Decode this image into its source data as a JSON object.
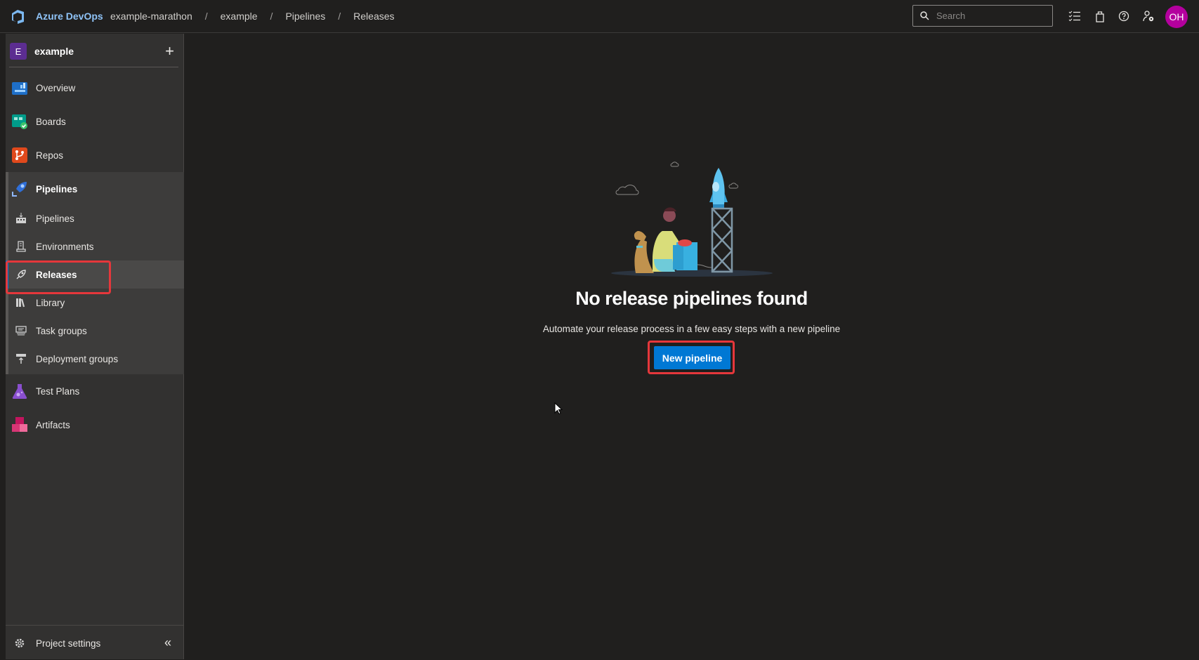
{
  "header": {
    "brand": "Azure DevOps",
    "breadcrumbs": [
      "example-marathon",
      "example",
      "Pipelines",
      "Releases"
    ],
    "breadcrumb_separator": "/",
    "search_placeholder": "Search",
    "avatar_initials": "OH",
    "avatar_color": "#b4009e"
  },
  "sidebar": {
    "project_initial": "E",
    "project_name": "example",
    "items": [
      {
        "label": "Overview",
        "icon": "overview-icon"
      },
      {
        "label": "Boards",
        "icon": "boards-icon"
      },
      {
        "label": "Repos",
        "icon": "repos-icon"
      },
      {
        "label": "Pipelines",
        "icon": "pipelines-icon"
      },
      {
        "label": "Test Plans",
        "icon": "test-plans-icon"
      },
      {
        "label": "Artifacts",
        "icon": "artifacts-icon"
      }
    ],
    "pipelines_sub": [
      {
        "label": "Pipelines",
        "icon": "pipelines-sub-icon"
      },
      {
        "label": "Environments",
        "icon": "environments-icon"
      },
      {
        "label": "Releases",
        "icon": "releases-icon",
        "selected": true
      },
      {
        "label": "Library",
        "icon": "library-icon"
      },
      {
        "label": "Task groups",
        "icon": "task-groups-icon"
      },
      {
        "label": "Deployment groups",
        "icon": "deployment-groups-icon"
      }
    ],
    "settings_label": "Project settings"
  },
  "main": {
    "title": "No release pipelines found",
    "subtitle": "Automate your release process in a few easy steps with a new pipeline",
    "button_label": "New pipeline",
    "accent": "#0078d4",
    "highlight": "#e5373b"
  }
}
